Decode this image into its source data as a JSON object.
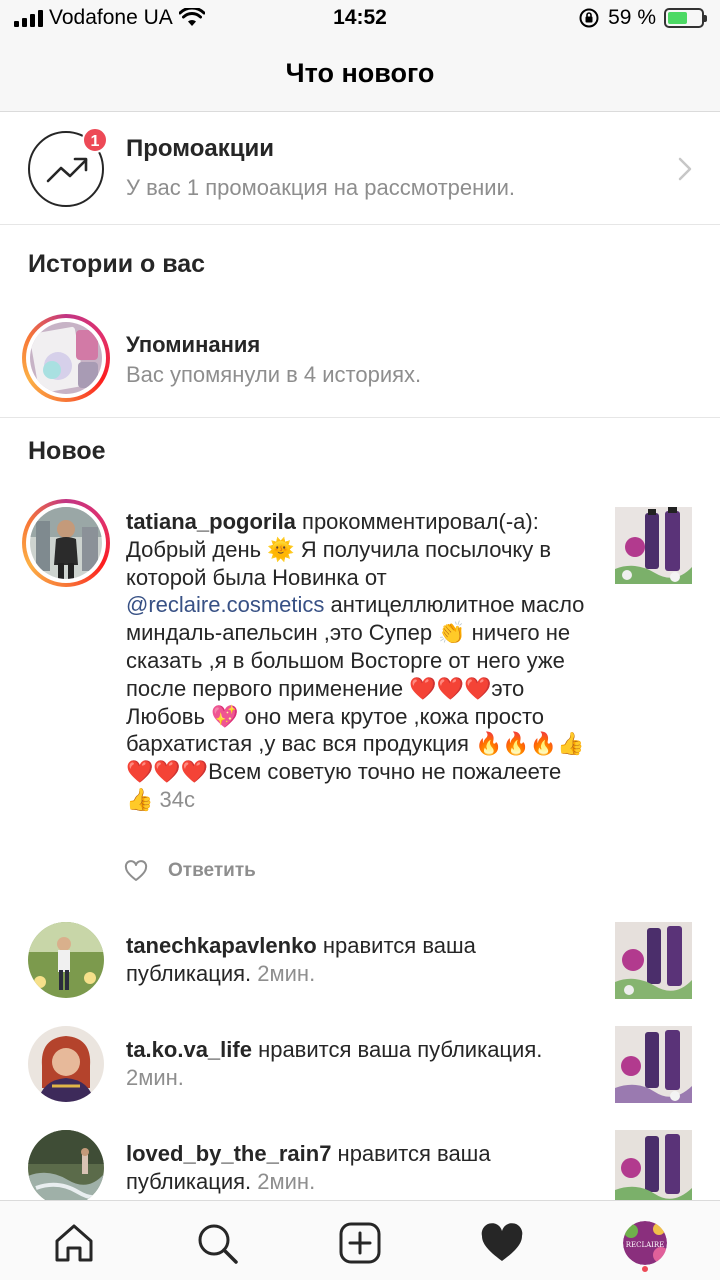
{
  "status_bar": {
    "carrier": "Vodafone UA",
    "time": "14:52",
    "battery": "59 %",
    "battery_level": 0.59
  },
  "header": {
    "title": "Что нового"
  },
  "promo": {
    "title": "Промоакции",
    "subtitle": "У вас 1 промоакция на рассмотрении.",
    "badge_count": "1"
  },
  "stories_section": {
    "title": "Истории о вас",
    "mentions_title": "Упоминания",
    "mentions_subtitle": "Вас упомянули в 4 историях."
  },
  "new_section": {
    "title": "Новое"
  },
  "comment": {
    "username": "tatiana_pogorila",
    "line1": " прокомментировал(-а): Добрый день 🌞 Я получила посылочку в которой была Новинка от ",
    "mention": "@reclaire.cosmetics",
    "line2": " антицеллюлитное масло миндаль-апельсин ,это Супер 👏 ничего не сказать ,я в большом Восторге от него уже после первого применение ❤️❤️❤️это Любовь 💖 оно мега крутое ,кожа просто бархатистая ,у вас вся продукция 🔥🔥🔥👍❤️❤️❤️Всем советую точно не пожалеете 👍 ",
    "time": "34с",
    "reply_label": "Ответить"
  },
  "likes": [
    {
      "username": "tanechkapavlenko",
      "action": " нравится ваша публикация. ",
      "time": "2мин."
    },
    {
      "username": "ta.ko.va_life",
      "action": " нравится ваша публикация. ",
      "time": "2мин."
    },
    {
      "username": "loved_by_the_rain7",
      "action": " нравится ваша публикация. ",
      "time": "2мин."
    }
  ],
  "tab_bar": {
    "items": [
      "home-icon",
      "search-icon",
      "new-post-icon",
      "activity-icon",
      "profile-icon"
    ],
    "profile_logo": "RECLAIRE"
  },
  "colors": {
    "accent": "#ed4956",
    "link": "#385185",
    "muted": "#8e8e8e"
  }
}
